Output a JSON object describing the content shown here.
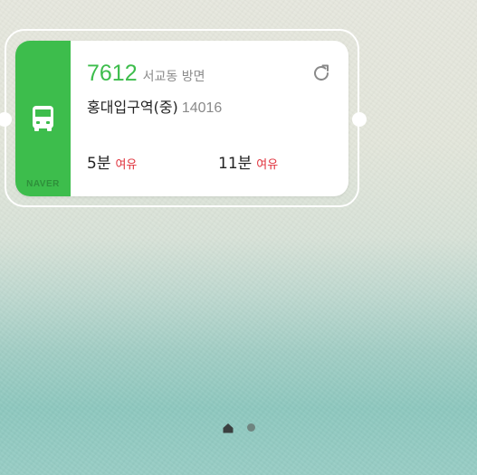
{
  "widget": {
    "brand": "NAVER",
    "brand_color": "#3dbd4c",
    "side_icon": "bus-icon",
    "route": {
      "number": "7612",
      "direction": "서교동 방면"
    },
    "stop": {
      "name": "홍대입구역(중)",
      "id": "14016"
    },
    "refresh_icon": "refresh-icon",
    "arrivals": [
      {
        "time": "5분",
        "status": "여유"
      },
      {
        "time": "11분",
        "status": "여유"
      }
    ],
    "status_color": "#e0323c"
  },
  "launcher": {
    "page_indicator": {
      "pages": [
        "home-icon",
        "page-dot"
      ],
      "current_page": 1
    }
  }
}
